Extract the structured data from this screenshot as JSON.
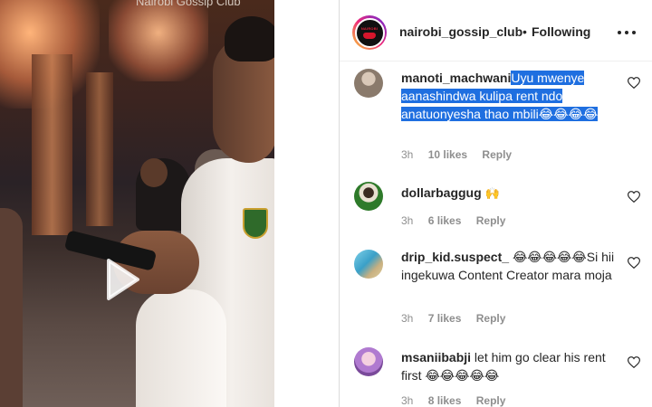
{
  "video": {
    "caption": "Nairobi Gossip Club"
  },
  "header": {
    "username": "nairobi_gossip_club",
    "separator": "•",
    "follow_state": "Following",
    "avatar_logo_text": "NAIROBI"
  },
  "comments": [
    {
      "username": "manoti_machwani",
      "text": "Uyu mwenye aanashindwa kulipa rent ndo anatuonyesha thao mbili😂😂😂😂",
      "time": "3h",
      "likes": "10 likes",
      "reply": "Reply"
    },
    {
      "username": "dollarbaggug",
      "text": "🙌",
      "time": "3h",
      "likes": "6 likes",
      "reply": "Reply"
    },
    {
      "username": "drip_kid.suspect_",
      "text": "😂😂😂😂😂Si hii ingekuwa Content Creator mara moja",
      "time": "3h",
      "likes": "7 likes",
      "reply": "Reply"
    },
    {
      "username": "msaniibabji",
      "text": "let him go clear his rent first 😂😂😂😂😂",
      "time": "3h",
      "likes": "8 likes",
      "reply": "Reply"
    }
  ],
  "icons": {
    "play": "play-icon",
    "more": "more-icon",
    "heart": "heart-icon"
  },
  "colors": {
    "highlight": "#1f6fe0",
    "text": "#262626",
    "meta": "#8e8e8e"
  }
}
